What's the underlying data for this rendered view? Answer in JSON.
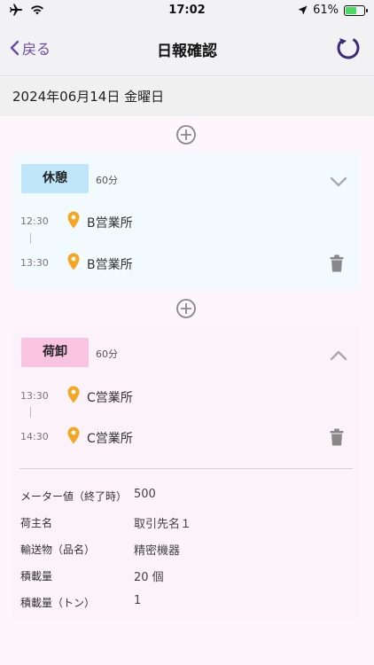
{
  "status_bar": {
    "time": "17:02",
    "battery": "61%",
    "battery_level": 0.61
  },
  "nav": {
    "back_label": "戻る",
    "title": "日報確認"
  },
  "date_header": "2024年06月14日 金曜日",
  "entries": [
    {
      "tag": "休憩",
      "duration": "60分",
      "stops": [
        {
          "time": "12:30",
          "location": "B営業所"
        },
        {
          "time": "13:30",
          "location": "B営業所"
        }
      ]
    },
    {
      "tag": "荷卸",
      "duration": "60分",
      "stops": [
        {
          "time": "13:30",
          "location": "C営業所"
        },
        {
          "time": "14:30",
          "location": "C営業所"
        }
      ],
      "details": [
        {
          "label": "メーター値（終了時）",
          "value": "500"
        },
        {
          "label": "荷主名",
          "value": "取引先名１"
        },
        {
          "label": "輸送物（品名）",
          "value": "精密機器"
        },
        {
          "label": "積載量",
          "value": "20 個"
        },
        {
          "label": "積載量（トン）",
          "value": "1"
        }
      ]
    }
  ],
  "colors": {
    "accent": "#6a4aa8",
    "rest_tag": "#bfe6f8",
    "load_tag": "#f9c4e2",
    "pin": "#f5a623"
  }
}
